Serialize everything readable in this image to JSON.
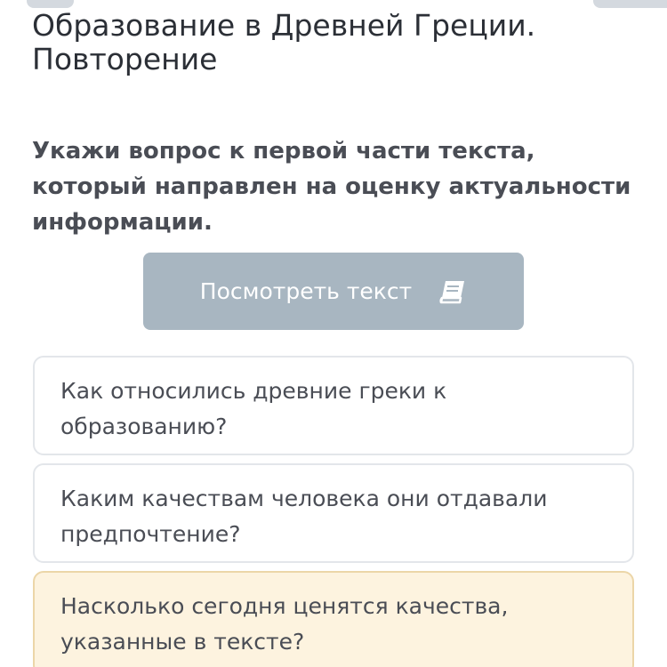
{
  "lesson": {
    "title": "Образование в Древней Греции. Повторение"
  },
  "question": {
    "text": "Укажи вопрос к первой части текста, который направлен на оценку актуальности информации."
  },
  "view_text_button": {
    "label": "Посмотреть текст",
    "icon": "book-icon",
    "color": "#a8b6c1"
  },
  "options": [
    {
      "text": "Как относились древние греки к образованию?",
      "selected": false
    },
    {
      "text": "Каким качествам человека они отдавали предпочтение?",
      "selected": false
    },
    {
      "text": "Насколько сегодня ценятся качества, указанные в тексте?",
      "selected": true
    }
  ],
  "colors": {
    "selected_background": "#fdf3df",
    "selected_border": "#ecd6a8",
    "option_border": "#e3e6ea"
  }
}
